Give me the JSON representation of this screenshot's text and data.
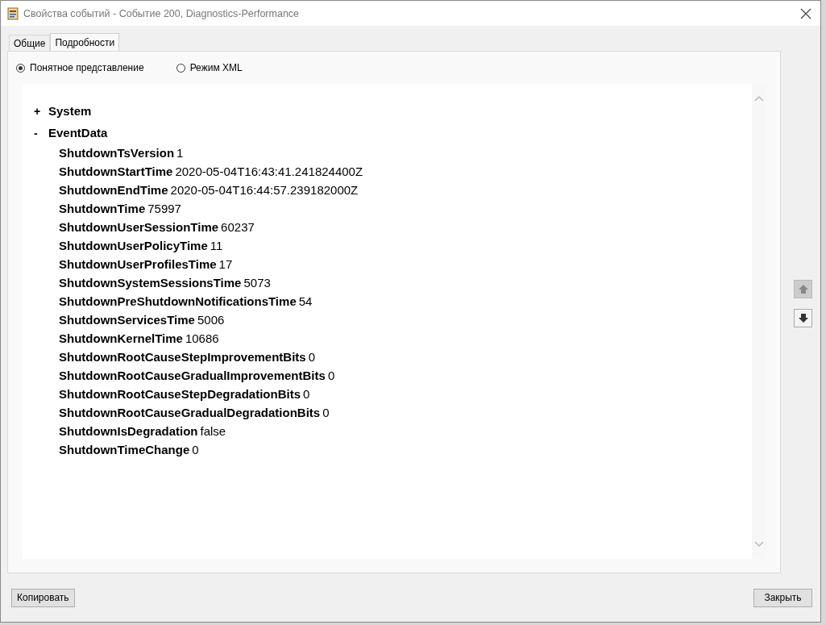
{
  "window": {
    "title": "Свойства событий - Событие 200, Diagnostics-Performance"
  },
  "tabs": [
    {
      "label": "Общие",
      "selected": false
    },
    {
      "label": "Подробности",
      "selected": true
    }
  ],
  "view_modes": [
    {
      "label": "Понятное представление",
      "selected": true
    },
    {
      "label": "Режим XML",
      "selected": false
    }
  ],
  "tree": [
    {
      "toggle": "+",
      "label": "System"
    },
    {
      "toggle": "-",
      "label": "EventData",
      "children": [
        {
          "name": "ShutdownTsVersion",
          "value": "1"
        },
        {
          "name": "ShutdownStartTime",
          "value": "2020-05-04T16:43:41.241824400Z"
        },
        {
          "name": "ShutdownEndTime",
          "value": "2020-05-04T16:44:57.239182000Z"
        },
        {
          "name": "ShutdownTime",
          "value": "75997"
        },
        {
          "name": "ShutdownUserSessionTime",
          "value": "60237"
        },
        {
          "name": "ShutdownUserPolicyTime",
          "value": "11"
        },
        {
          "name": "ShutdownUserProfilesTime",
          "value": "17"
        },
        {
          "name": "ShutdownSystemSessionsTime",
          "value": "5073"
        },
        {
          "name": "ShutdownPreShutdownNotificationsTime",
          "value": "54"
        },
        {
          "name": "ShutdownServicesTime",
          "value": "5006"
        },
        {
          "name": "ShutdownKernelTime",
          "value": "10686"
        },
        {
          "name": "ShutdownRootCauseStepImprovementBits",
          "value": "0"
        },
        {
          "name": "ShutdownRootCauseGradualImprovementBits",
          "value": "0"
        },
        {
          "name": "ShutdownRootCauseStepDegradationBits",
          "value": "0"
        },
        {
          "name": "ShutdownRootCauseGradualDegradationBits",
          "value": "0"
        },
        {
          "name": "ShutdownIsDegradation",
          "value": "false"
        },
        {
          "name": "ShutdownTimeChange",
          "value": "0"
        }
      ]
    }
  ],
  "nav_buttons": [
    {
      "kind": "up",
      "disabled": true
    },
    {
      "kind": "down",
      "disabled": false
    }
  ],
  "buttons": [
    {
      "label": "Копировать"
    },
    {
      "label": "Закрыть"
    }
  ]
}
